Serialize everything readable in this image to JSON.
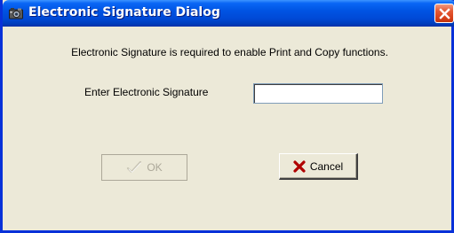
{
  "window": {
    "title": "Electronic Signature Dialog",
    "title_icon": "camera-icon",
    "close_icon": "close-icon"
  },
  "dialog": {
    "message": "Electronic Signature is required to enable Print and Copy functions.",
    "signature_label": "Enter Electronic Signature",
    "signature_value": "",
    "signature_placeholder": ""
  },
  "buttons": {
    "ok_label": "OK",
    "ok_icon": "checkmark-icon",
    "ok_enabled": false,
    "cancel_label": "Cancel",
    "cancel_icon": "red-x-icon"
  },
  "colors": {
    "titlebar": "#0054E3",
    "close_button": "#D8401A",
    "dialog_background": "#ECE9D8",
    "disabled_text": "#ACA899",
    "cancel_x": "#B00000"
  }
}
